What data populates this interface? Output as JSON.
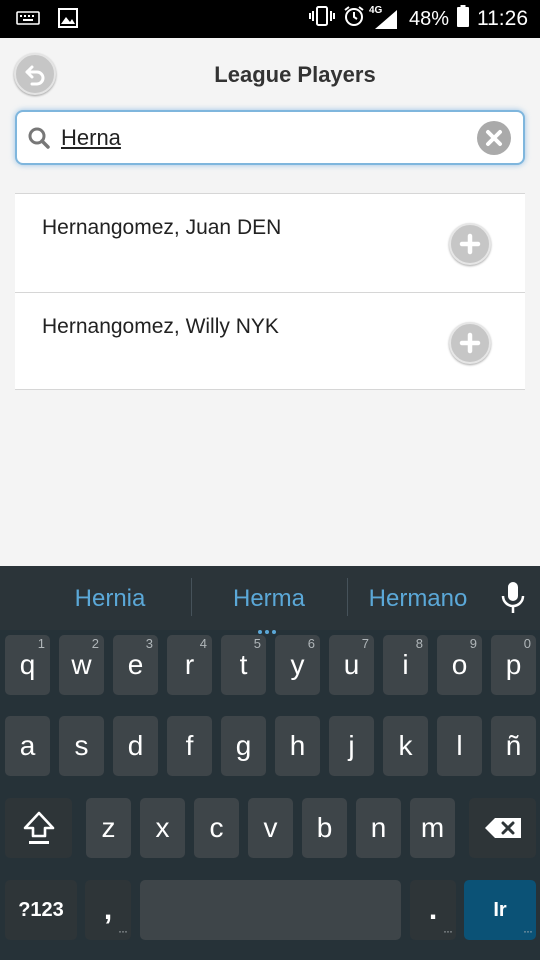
{
  "status_bar": {
    "battery_pct": "48%",
    "time": "11:26",
    "network": "4G"
  },
  "header": {
    "title": "League Players"
  },
  "search": {
    "value": "Herna",
    "placeholder": ""
  },
  "results": [
    {
      "name": "Hernangomez, Juan DEN"
    },
    {
      "name": "Hernangomez, Willy NYK"
    }
  ],
  "keyboard": {
    "suggestions": [
      "Hernia",
      "Herma",
      "Hermano"
    ],
    "row1": [
      {
        "k": "q",
        "h": "1"
      },
      {
        "k": "w",
        "h": "2"
      },
      {
        "k": "e",
        "h": "3"
      },
      {
        "k": "r",
        "h": "4"
      },
      {
        "k": "t",
        "h": "5"
      },
      {
        "k": "y",
        "h": "6"
      },
      {
        "k": "u",
        "h": "7"
      },
      {
        "k": "i",
        "h": "8"
      },
      {
        "k": "o",
        "h": "9"
      },
      {
        "k": "p",
        "h": "0"
      }
    ],
    "row2": [
      "a",
      "s",
      "d",
      "f",
      "g",
      "h",
      "j",
      "k",
      "l",
      "ñ"
    ],
    "row3": [
      "z",
      "x",
      "c",
      "v",
      "b",
      "n",
      "m"
    ],
    "symbols_label": "?123",
    "comma_label": ",",
    "period_label": ".",
    "enter_label": "Ir"
  }
}
